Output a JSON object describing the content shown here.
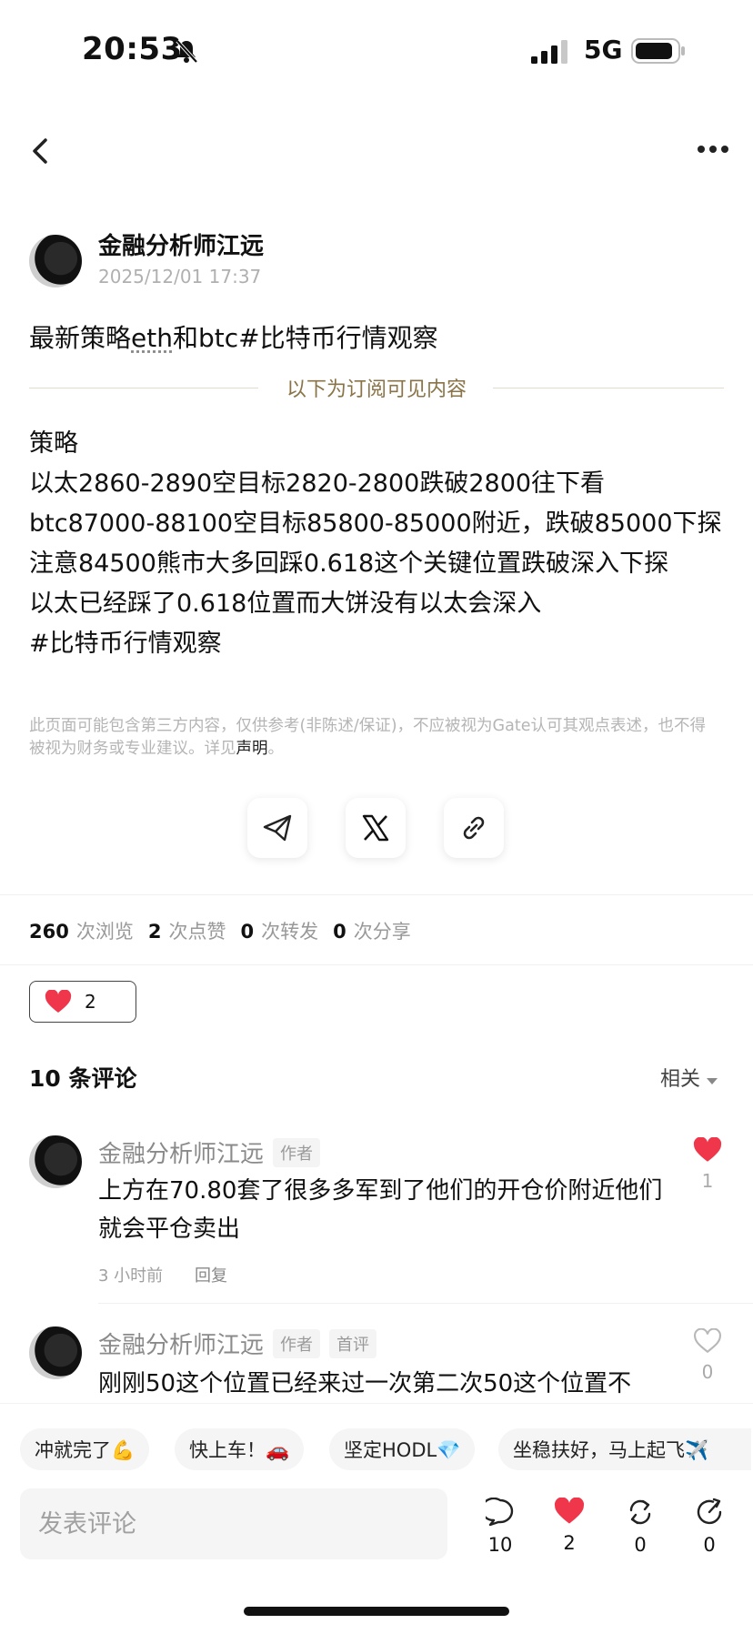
{
  "status_bar": {
    "time": "20:53",
    "network": "5G"
  },
  "author": {
    "name": "金融分析师江远",
    "date": "2025/12/01 17:37"
  },
  "post": {
    "title_prefix": "最新策略",
    "title_eth": "eth",
    "title_suffix": "和btc#比特币行情观察",
    "subscriber_divider": "以下为订阅可见内容",
    "body": "策略\n以太2860-2890空目标2820-2800跌破2800往下看\nbtc87000-88100空目标85800-85000附近，跌破85000下探\n注意84500熊市大多回踩0.618这个关键位置跌破深入下探\n以太已经踩了0.618位置而大饼没有以太会深入\n#比特币行情观察",
    "disclaimer": "此页面可能包含第三方内容，仅供参考(非陈述/保证)，不应被视为Gate认可其观点表述，也不得被视为财务或专业建议。详见",
    "disclaimer_link": "声明",
    "disclaimer_end": "。"
  },
  "share": {
    "icons": [
      "telegram-icon",
      "x-icon",
      "link-icon"
    ]
  },
  "stats": {
    "views": "260",
    "views_label": "次浏览",
    "likes": "2",
    "likes_label": "次点赞",
    "reposts": "0",
    "reposts_label": "次转发",
    "shares": "0",
    "shares_label": "次分享"
  },
  "like_pill": {
    "count": "2"
  },
  "comments": {
    "title": "10 条评论",
    "sort": "相关",
    "items": [
      {
        "name": "金融分析师江远",
        "tags": [
          "作者"
        ],
        "text": "上方在70.80套了很多多军到了他们的开仓价附近他们就会平仓卖出",
        "time": "3 小时前",
        "reply": "回复",
        "likes": "1",
        "liked": true
      },
      {
        "name": "金融分析师江远",
        "tags": [
          "作者",
          "首评"
        ],
        "text": "刚刚50这个位置已经来过一次第二次50这个位置不",
        "likes": "0",
        "liked": false
      }
    ]
  },
  "quick_replies": [
    "冲就完了💪",
    "快上车！🚗",
    "坚定HODL💎",
    "坐稳扶好，马上起飞✈️"
  ],
  "composer": {
    "placeholder": "发表评论"
  },
  "actions": {
    "comments": "10",
    "likes": "2",
    "reposts": "0",
    "shares": "0"
  },
  "colors": {
    "accent_red": "#f0364b",
    "divider_gold": "#8a7346"
  }
}
